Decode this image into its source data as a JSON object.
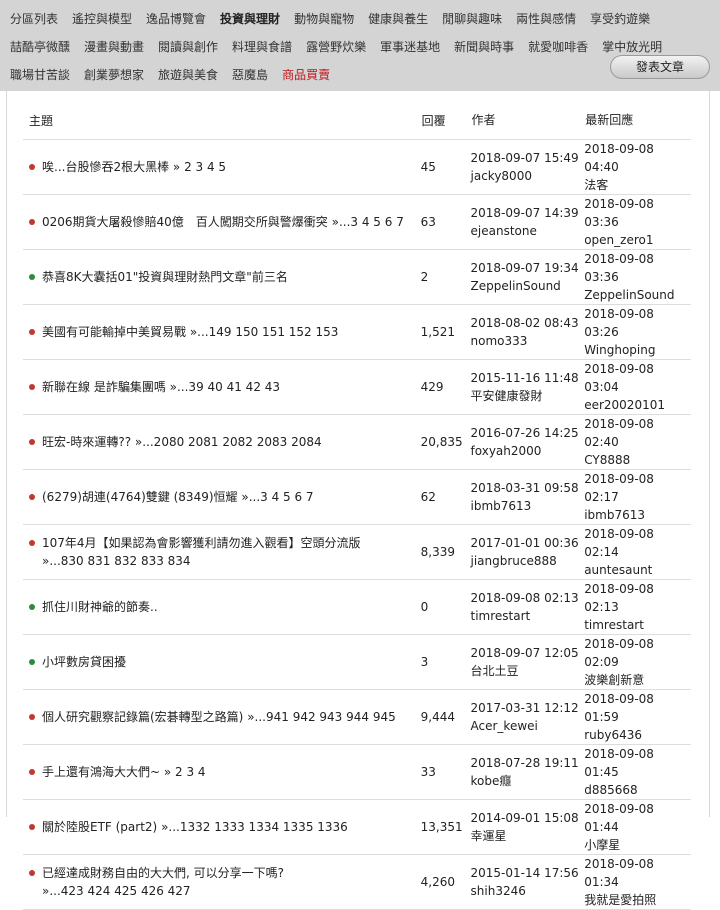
{
  "nav": {
    "rows": [
      [
        {
          "label": "分區列表",
          "state": "normal"
        },
        {
          "label": "遙控與模型",
          "state": "normal"
        },
        {
          "label": "逸品博覽會",
          "state": "normal"
        },
        {
          "label": "投資與理財",
          "state": "active"
        },
        {
          "label": "動物與寵物",
          "state": "normal"
        },
        {
          "label": "健康與養生",
          "state": "normal"
        },
        {
          "label": "閒聊與趣味",
          "state": "normal"
        },
        {
          "label": "兩性與感情",
          "state": "normal"
        },
        {
          "label": "享受釣遊樂",
          "state": "normal"
        }
      ],
      [
        {
          "label": "喆酷亭微醺",
          "state": "normal"
        },
        {
          "label": "漫畫與動畫",
          "state": "normal"
        },
        {
          "label": "閱讀與創作",
          "state": "normal"
        },
        {
          "label": "料理與食譜",
          "state": "normal"
        },
        {
          "label": "露營野炊樂",
          "state": "normal"
        },
        {
          "label": "軍事迷基地",
          "state": "normal"
        },
        {
          "label": "新聞與時事",
          "state": "normal"
        },
        {
          "label": "就愛咖啡香",
          "state": "normal"
        },
        {
          "label": "掌中放光明",
          "state": "normal"
        }
      ],
      [
        {
          "label": "職場甘苦談",
          "state": "normal"
        },
        {
          "label": "創業夢想家",
          "state": "normal"
        },
        {
          "label": "旅遊與美食",
          "state": "normal"
        },
        {
          "label": "惡魔島",
          "state": "normal"
        },
        {
          "label": "商品買賣",
          "state": "hot"
        }
      ]
    ],
    "post_button": "發表文章"
  },
  "table": {
    "headers": {
      "topic": "主題",
      "replies": "回覆",
      "author": "作者",
      "last_reply": "最新回應"
    },
    "rows": [
      {
        "dot": "#c0392b",
        "title": "唉...台股慘吞2根大黑棒",
        "pages": " » 2 3 4 5",
        "replies": "45",
        "author_time": "2018-09-07 15:49",
        "author": "jacky8000",
        "last_time": "2018-09-08 04:40",
        "last_user": "法客"
      },
      {
        "dot": "#c0392b",
        "title": "0206期貨大屠殺慘賠40億　百人闖期交所與警爆衝突",
        "pages": " »...3 4 5 6 7",
        "replies": "63",
        "author_time": "2018-09-07 14:39",
        "author": "ejeanstone",
        "last_time": "2018-09-08 03:36",
        "last_user": "open_zero1"
      },
      {
        "dot": "#2e8b3d",
        "title": "恭喜8K大囊括01\"投資與理財熱門文章\"前三名",
        "pages": "",
        "replies": "2",
        "author_time": "2018-09-07 19:34",
        "author": "ZeppelinSound",
        "last_time": "2018-09-08 03:36",
        "last_user": "ZeppelinSound"
      },
      {
        "dot": "#c0392b",
        "title": "美國有可能輸掉中美貿易戰",
        "pages": " »...149 150 151 152 153",
        "replies": "1,521",
        "author_time": "2018-08-02 08:43",
        "author": "nomo333",
        "last_time": "2018-09-08 03:26",
        "last_user": "Winghoping"
      },
      {
        "dot": "#c0392b",
        "title": "新聯在線 是詐騙集團嗎",
        "pages": " »...39 40 41 42 43",
        "replies": "429",
        "author_time": "2015-11-16 11:48",
        "author": "平安健康發財",
        "last_time": "2018-09-08 03:04",
        "last_user": "eer20020101"
      },
      {
        "dot": "#c0392b",
        "title": "旺宏-時來運轉??",
        "pages": " »...2080 2081 2082 2083 2084",
        "replies": "20,835",
        "author_time": "2016-07-26 14:25",
        "author": "foxyah2000",
        "last_time": "2018-09-08 02:40",
        "last_user": "CY8888"
      },
      {
        "dot": "#c0392b",
        "title": "(6279)胡連(4764)雙鍵 (8349)恒耀",
        "pages": " »...3 4 5 6 7",
        "replies": "62",
        "author_time": "2018-03-31 09:58",
        "author": "ibmb7613",
        "last_time": "2018-09-08 02:17",
        "last_user": "ibmb7613"
      },
      {
        "dot": "#c0392b",
        "title": "107年4月【如果認為會影響獲利請勿進入觀看】空頭分流版",
        "pages": " »...830 831 832 833 834",
        "replies": "8,339",
        "author_time": "2017-01-01 00:36",
        "author": "jiangbruce888",
        "last_time": "2018-09-08 02:14",
        "last_user": "auntesaunt",
        "wrap": true
      },
      {
        "dot": "#2e8b3d",
        "title": "抓住川財神爺的節奏..",
        "pages": "",
        "replies": "0",
        "author_time": "2018-09-08 02:13",
        "author": "timrestart",
        "last_time": "2018-09-08 02:13",
        "last_user": "timrestart"
      },
      {
        "dot": "#2e8b3d",
        "title": "小坪數房貸困擾",
        "pages": "",
        "replies": "3",
        "author_time": "2018-09-07 12:05",
        "author": "台北土豆",
        "last_time": "2018-09-08 02:09",
        "last_user": "波樂創新意"
      },
      {
        "dot": "#c0392b",
        "title": "個人研究觀察記錄篇(宏碁轉型之路篇)",
        "pages": " »...941 942 943 944 945",
        "replies": "9,444",
        "author_time": "2017-03-31 12:12",
        "author": "Acer_kewei",
        "last_time": "2018-09-08 01:59",
        "last_user": "ruby6436"
      },
      {
        "dot": "#c0392b",
        "title": "手上還有鴻海大大們~",
        "pages": " » 2 3 4",
        "replies": "33",
        "author_time": "2018-07-28 19:11",
        "author": "kobe癮",
        "last_time": "2018-09-08 01:45",
        "last_user": "d885668"
      },
      {
        "dot": "#c0392b",
        "title": "關於陸股ETF (part2)",
        "pages": " »...1332 1333 1334 1335 1336",
        "replies": "13,351",
        "author_time": "2014-09-01 15:08",
        "author": "幸運星",
        "last_time": "2018-09-08 01:44",
        "last_user": "小摩星"
      },
      {
        "dot": "#c0392b",
        "title": "已經達成財務自由的大大們, 可以分享一下嗎?",
        "pages": " »...423 424 425 426 427",
        "replies": "4,260",
        "author_time": "2015-01-14 17:56",
        "author": "shih3246",
        "last_time": "2018-09-08 01:34",
        "last_user": "我就是愛拍照",
        "wrap": true
      }
    ]
  }
}
